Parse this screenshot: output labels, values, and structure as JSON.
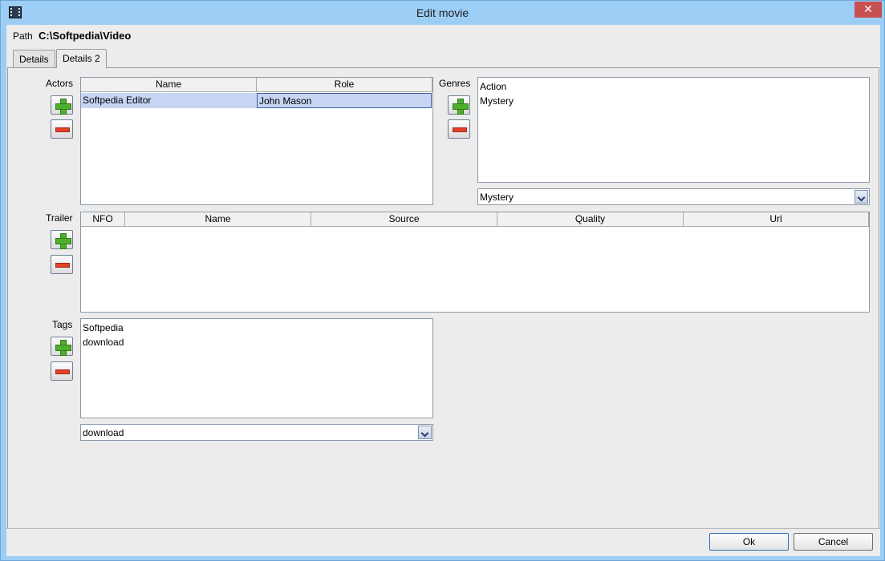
{
  "window": {
    "title": "Edit movie"
  },
  "path": {
    "label": "Path",
    "value": "C:\\Softpedia\\Video"
  },
  "tabs": [
    {
      "label": "Details",
      "active": false
    },
    {
      "label": "Details 2",
      "active": true
    }
  ],
  "actors": {
    "label": "Actors",
    "columns": [
      "Name",
      "Role"
    ],
    "rows": [
      {
        "name": "Softpedia Editor",
        "role": "John Mason"
      }
    ]
  },
  "genres": {
    "label": "Genres",
    "items": [
      "Action",
      "Mystery"
    ],
    "selected": "Mystery"
  },
  "trailer": {
    "label": "Trailer",
    "columns": [
      "NFO",
      "Name",
      "Source",
      "Quality",
      "Url"
    ]
  },
  "tags": {
    "label": "Tags",
    "items": [
      "Softpedia",
      "download"
    ],
    "selected": "download"
  },
  "buttons": {
    "ok": "Ok",
    "cancel": "Cancel"
  },
  "icons": {
    "add": "plus-icon",
    "remove": "minus-icon",
    "app": "film-icon",
    "close": "close-icon",
    "dropdown": "chevron-down-icon"
  },
  "colors": {
    "titlebar": "#9ccdf5",
    "close_button": "#c75050",
    "selection": "#c7d5f2",
    "add_icon": "#4fae2d",
    "remove_icon": "#e2432a"
  }
}
